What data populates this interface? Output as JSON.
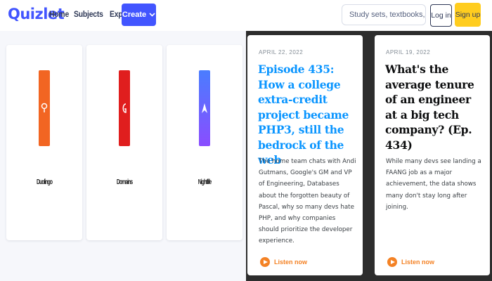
{
  "quizlet": {
    "logo": "Quizlet",
    "nav": [
      "Home",
      "Subjects",
      "Explanations"
    ],
    "create_label": "Create",
    "search_placeholder": "Study sets, textbooks, ...",
    "login_label": "Log in",
    "signup_label": "Sign up",
    "accent": "#4255ff",
    "cards": [
      {
        "icon": "orange-app-logo",
        "color": "#f26522",
        "caption": "Duolingo"
      },
      {
        "icon": "red-app-logo",
        "color": "#e01e1e",
        "caption": "Domains"
      },
      {
        "icon": "blue-arrow-app-logo",
        "color": "#6a5bff",
        "caption": "Nightlife"
      }
    ]
  },
  "podcast": {
    "cards": [
      {
        "date": "APRIL 22, 2022",
        "title": "Episode 435: How a college extra-credit project became PHP3, still the bedrock of the web",
        "title_color": "#0a95ff",
        "description": "The home team chats with Andi Gutmans, Google's GM and VP of Engineering, Databases about the forgotten beauty of Pascal, why so many devs hate PHP, and why companies should prioritize the developer experience.",
        "listen_label": "Listen now"
      },
      {
        "date": "APRIL 19, 2022",
        "title": "What's the average tenure of an engineer at a big tech company? (Ep. 434)",
        "title_color": "#0c0d0e",
        "description": "While many devs see landing a FAANG job as a major achievement, the data shows many don't stay long after joining.",
        "listen_label": "Listen now"
      }
    ],
    "accent": "#f48225"
  }
}
